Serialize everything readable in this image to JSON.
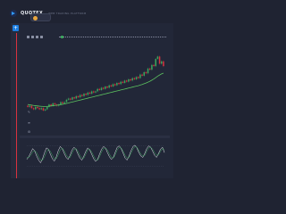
{
  "header": {
    "brand": "QUOTEX",
    "tagline": "WEB TRADING PLATFORM",
    "account": {
      "label": "",
      "sub": ""
    }
  },
  "toolbar": {
    "add_label": "+"
  },
  "chart": {
    "pair_label": ""
  },
  "colors": {
    "background": "#1f2332",
    "panel": "#222738",
    "bull": "#3ba55d",
    "bear": "#d8323f",
    "ma": "#5cc25f",
    "accent": "#1c7ee0",
    "osc_a": "#e6e9ef",
    "osc_b": "#3ba55d"
  },
  "icons": [
    "quotex-logo-icon",
    "plus-icon",
    "pencil-icon",
    "indicator-icon",
    "settings-icon"
  ],
  "chart_data": {
    "type": "candlestick",
    "title": "",
    "candles": [
      {
        "o": 25,
        "c": 24
      },
      {
        "o": 24,
        "c": 25
      },
      {
        "o": 25,
        "c": 23
      },
      {
        "o": 23,
        "c": 22
      },
      {
        "o": 22,
        "c": 24
      },
      {
        "o": 24,
        "c": 23
      },
      {
        "o": 23,
        "c": 22
      },
      {
        "o": 22,
        "c": 23
      },
      {
        "o": 23,
        "c": 21
      },
      {
        "o": 21,
        "c": 22
      },
      {
        "o": 22,
        "c": 24
      },
      {
        "o": 24,
        "c": 26
      },
      {
        "o": 26,
        "c": 25
      },
      {
        "o": 25,
        "c": 27
      },
      {
        "o": 27,
        "c": 26
      },
      {
        "o": 26,
        "c": 25
      },
      {
        "o": 25,
        "c": 26
      },
      {
        "o": 26,
        "c": 28
      },
      {
        "o": 28,
        "c": 27
      },
      {
        "o": 27,
        "c": 28
      },
      {
        "o": 28,
        "c": 30
      },
      {
        "o": 30,
        "c": 31
      },
      {
        "o": 31,
        "c": 30
      },
      {
        "o": 30,
        "c": 32
      },
      {
        "o": 32,
        "c": 31
      },
      {
        "o": 31,
        "c": 33
      },
      {
        "o": 33,
        "c": 32
      },
      {
        "o": 32,
        "c": 34
      },
      {
        "o": 34,
        "c": 33
      },
      {
        "o": 33,
        "c": 35
      },
      {
        "o": 35,
        "c": 34
      },
      {
        "o": 34,
        "c": 36
      },
      {
        "o": 36,
        "c": 35
      },
      {
        "o": 35,
        "c": 37
      },
      {
        "o": 37,
        "c": 36
      },
      {
        "o": 36,
        "c": 37
      },
      {
        "o": 37,
        "c": 39
      },
      {
        "o": 39,
        "c": 38
      },
      {
        "o": 38,
        "c": 40
      },
      {
        "o": 40,
        "c": 39
      },
      {
        "o": 39,
        "c": 41
      },
      {
        "o": 41,
        "c": 40
      },
      {
        "o": 40,
        "c": 42
      },
      {
        "o": 42,
        "c": 41
      },
      {
        "o": 41,
        "c": 43
      },
      {
        "o": 43,
        "c": 42
      },
      {
        "o": 42,
        "c": 44
      },
      {
        "o": 44,
        "c": 43
      },
      {
        "o": 43,
        "c": 45
      },
      {
        "o": 45,
        "c": 44
      },
      {
        "o": 44,
        "c": 46
      },
      {
        "o": 46,
        "c": 45
      },
      {
        "o": 45,
        "c": 47
      },
      {
        "o": 47,
        "c": 46
      },
      {
        "o": 46,
        "c": 48
      },
      {
        "o": 48,
        "c": 47
      },
      {
        "o": 47,
        "c": 49
      },
      {
        "o": 49,
        "c": 48
      },
      {
        "o": 48,
        "c": 51
      },
      {
        "o": 51,
        "c": 50
      },
      {
        "o": 50,
        "c": 53
      },
      {
        "o": 53,
        "c": 52
      },
      {
        "o": 52,
        "c": 56
      },
      {
        "o": 56,
        "c": 55
      },
      {
        "o": 55,
        "c": 59
      },
      {
        "o": 59,
        "c": 58
      },
      {
        "o": 58,
        "c": 64
      },
      {
        "o": 64,
        "c": 66
      },
      {
        "o": 66,
        "c": 60
      },
      {
        "o": 60,
        "c": 62
      },
      {
        "o": 62,
        "c": 58
      }
    ],
    "ma": [
      26,
      25.8,
      25.5,
      25.2,
      25,
      24.8,
      24.6,
      24.5,
      24.4,
      24.3,
      24.4,
      24.6,
      24.8,
      25,
      25.2,
      25.4,
      25.6,
      25.9,
      26.2,
      26.5,
      26.9,
      27.3,
      27.7,
      28.1,
      28.5,
      28.9,
      29.3,
      29.7,
      30.1,
      30.5,
      30.9,
      31.3,
      31.7,
      32.1,
      32.5,
      32.9,
      33.3,
      33.7,
      34.1,
      34.5,
      34.9,
      35.3,
      35.7,
      36.1,
      36.5,
      36.9,
      37.3,
      37.7,
      38.1,
      38.5,
      38.9,
      39.3,
      39.7,
      40.1,
      40.5,
      40.9,
      41.3,
      41.7,
      42.2,
      42.7,
      43.3,
      43.9,
      44.6,
      45.4,
      46.3,
      47.3,
      48.4,
      49.6,
      50.6,
      51.5,
      52.2
    ],
    "ylim": [
      15,
      70
    ],
    "oscillator": {
      "ylim": [
        0,
        100
      ],
      "series": [
        {
          "values": [
            40,
            48,
            60,
            72,
            65,
            50,
            38,
            30,
            42,
            60,
            74,
            70,
            55,
            42,
            35,
            48,
            66,
            78,
            72,
            58,
            46,
            40,
            52,
            68,
            76,
            70,
            56,
            44,
            38,
            50,
            64,
            74,
            68,
            55,
            42,
            34,
            40,
            56,
            70,
            78,
            74,
            60,
            48,
            40,
            46,
            62,
            76,
            80,
            72,
            58,
            44,
            38,
            50,
            66,
            78,
            82,
            74,
            60,
            50,
            46,
            58,
            72,
            80,
            76,
            64,
            52,
            46,
            58,
            70,
            76,
            60
          ]
        },
        {
          "values": [
            45,
            46,
            52,
            62,
            66,
            60,
            48,
            38,
            38,
            48,
            62,
            70,
            64,
            52,
            42,
            42,
            54,
            68,
            74,
            66,
            54,
            46,
            46,
            58,
            70,
            72,
            64,
            52,
            44,
            44,
            56,
            68,
            70,
            62,
            50,
            40,
            38,
            48,
            62,
            72,
            74,
            68,
            56,
            46,
            44,
            54,
            68,
            76,
            74,
            64,
            52,
            44,
            46,
            58,
            70,
            78,
            76,
            66,
            56,
            50,
            52,
            64,
            74,
            76,
            70,
            60,
            52,
            54,
            64,
            72,
            68
          ]
        }
      ]
    }
  }
}
